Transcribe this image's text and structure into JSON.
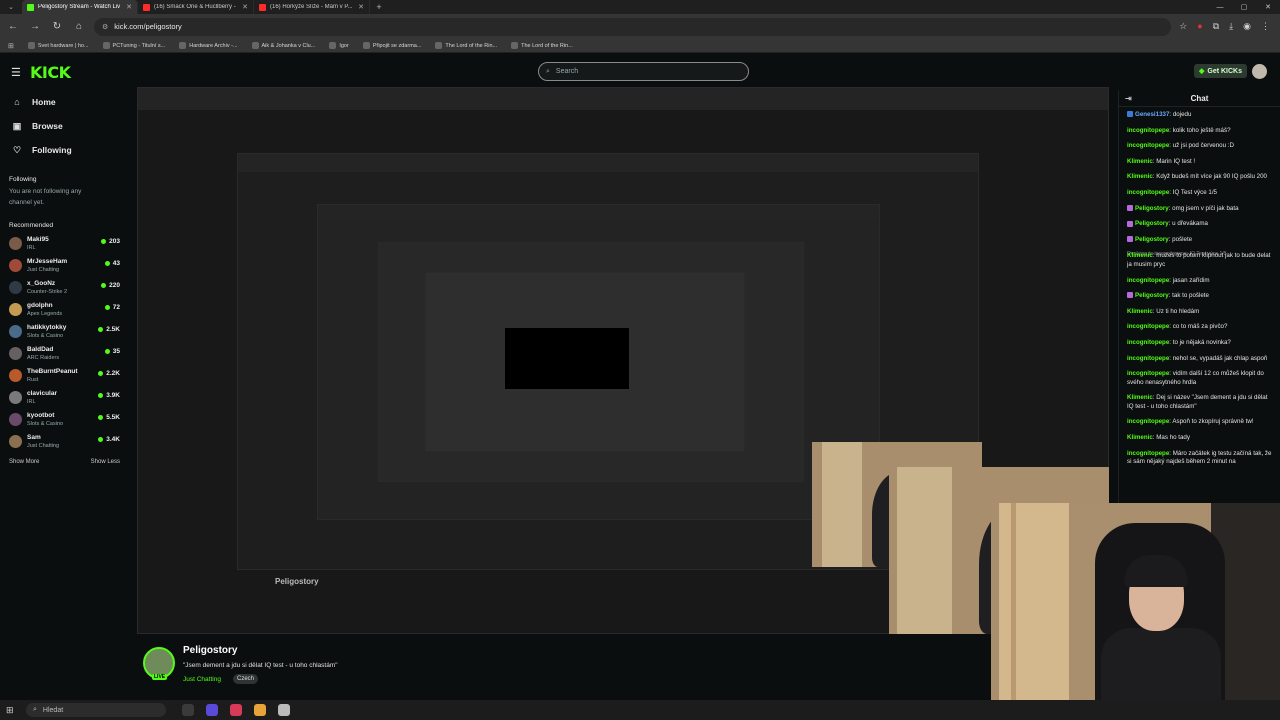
{
  "browser": {
    "tabs": [
      {
        "title": "Peligostory Stream - Watch Liv",
        "color": "#53fc18",
        "active": true
      },
      {
        "title": "(16) Smack One & Hucllberry -",
        "color": "#ff2b2b",
        "active": false
      },
      {
        "title": "(16) Horkýže Slíže - Mám v P...",
        "color": "#ff2b2b",
        "active": false
      }
    ],
    "url": "kick.com/peligostory",
    "bookmarks": [
      "Svet hardware | ho...",
      "PCTuning - Titulní s...",
      "Hardware Archiv -...",
      "Aik & Johanka v Clu...",
      "Igor",
      "Připojit se zdarma...",
      "The Lord of the Rin...",
      "The Lord of the Rin..."
    ]
  },
  "header": {
    "logo": "KICK",
    "search_placeholder": "Search",
    "get_kicks": "Get KICKs"
  },
  "sidebar": {
    "nav": [
      {
        "label": "Home",
        "icon": "home-icon",
        "glyph": "⌂"
      },
      {
        "label": "Browse",
        "icon": "browse-icon",
        "glyph": "▣"
      },
      {
        "label": "Following",
        "icon": "heart-icon",
        "glyph": "♡"
      }
    ],
    "following_heading": "Following",
    "following_note": "You are not following any channel yet.",
    "recommended_heading": "Recommended",
    "recommended": [
      {
        "name": "Maki95",
        "category": "IRL",
        "viewers": "203",
        "color": "#7a5a48"
      },
      {
        "name": "MrJesseHam",
        "category": "Just Chatting",
        "viewers": "43",
        "color": "#a04a3a"
      },
      {
        "name": "x_GooNz",
        "category": "Counter-Strike 2",
        "viewers": "220",
        "color": "#303a46"
      },
      {
        "name": "gdolphn",
        "category": "Apex Legends",
        "viewers": "72",
        "color": "#c49a52"
      },
      {
        "name": "hatikkytokky",
        "category": "Slots & Casino",
        "viewers": "2.5K",
        "color": "#4a6a8a"
      },
      {
        "name": "BaldDad",
        "category": "ARC Raiders",
        "viewers": "35",
        "color": "#666060"
      },
      {
        "name": "TheBurntPeanut",
        "category": "Rust",
        "viewers": "2.2K",
        "color": "#b85a2a"
      },
      {
        "name": "clavicular",
        "category": "IRL",
        "viewers": "3.9K",
        "color": "#7a7a7a"
      },
      {
        "name": "kyootbot",
        "category": "Slots & Casino",
        "viewers": "5.5K",
        "color": "#6a4a6a"
      },
      {
        "name": "Sam",
        "category": "Just Chatting",
        "viewers": "3.4K",
        "color": "#8a7050"
      }
    ],
    "show_more": "Show More",
    "show_less": "Show Less"
  },
  "stream": {
    "streamer": "Peligostory",
    "title": "\"Jsem dement a jdu si dělat IQ test - u toho chlastám\"",
    "category": "Just Chatting",
    "tag": "Czech",
    "live_badge": "LIVE"
  },
  "chat": {
    "heading": "Chat",
    "messages": [
      {
        "user": "Genesi1337",
        "text": "dojedu",
        "color": "#6aa8ff",
        "badge": "#3a7ad8",
        "reply": ""
      },
      {
        "user": "incognitopepe",
        "text": "kolik toho ještě máš?",
        "color": "#53fc18",
        "badge": "",
        "reply": ""
      },
      {
        "user": "incognitopepe",
        "text": "už jsi pod červenou :D",
        "color": "#53fc18",
        "badge": "",
        "reply": ""
      },
      {
        "user": "Klimenic",
        "text": "Marin IQ test !",
        "color": "#53fc18",
        "badge": "",
        "reply": ""
      },
      {
        "user": "Klimenic",
        "text": "Když budeš mít více jak 90 IQ pošlu 200",
        "color": "#53fc18",
        "badge": "",
        "reply": ""
      },
      {
        "user": "incognitopepe",
        "text": "IQ Test výce 1/5",
        "color": "#53fc18",
        "badge": "",
        "reply": ""
      },
      {
        "user": "Peligostory",
        "text": "omg jsem v píči jak bata",
        "color": "#53fc18",
        "badge": "#b46ad8",
        "reply": ""
      },
      {
        "user": "Peligostory",
        "text": "u dřevákama",
        "color": "#53fc18",
        "badge": "#b46ad8",
        "reply": ""
      },
      {
        "user": "Peligostory",
        "text": "pošlete",
        "color": "#53fc18",
        "badge": "#b46ad8",
        "reply": ""
      },
      {
        "user": "Klimenic",
        "text": "muzes to potom klipnout jak to bude delat ja musim pryc",
        "color": "#53fc18",
        "badge": "",
        "reply": "Replying to incognitopepe: IQ Test výce 1/5"
      },
      {
        "user": "incognitopepe",
        "text": "jasan zařídim",
        "color": "#53fc18",
        "badge": "",
        "reply": ""
      },
      {
        "user": "Peligostory",
        "text": "tak to pošlete",
        "color": "#53fc18",
        "badge": "#b46ad8",
        "reply": ""
      },
      {
        "user": "Klimenic",
        "text": "Uz ti ho hledám",
        "color": "#53fc18",
        "badge": "",
        "reply": ""
      },
      {
        "user": "incognitopepe",
        "text": "co to máš za pivčo?",
        "color": "#53fc18",
        "badge": "",
        "reply": ""
      },
      {
        "user": "incognitopepe",
        "text": "to je nějaká novinka?",
        "color": "#53fc18",
        "badge": "",
        "reply": ""
      },
      {
        "user": "incognitopepe",
        "text": "nehol se, vypadáš jak chlap aspoň",
        "color": "#53fc18",
        "badge": "",
        "reply": ""
      },
      {
        "user": "incognitopepe",
        "text": "vidím další 12 co můžeš klopit do svého nenasytného hrdla",
        "color": "#53fc18",
        "badge": "",
        "reply": ""
      },
      {
        "user": "Klimenic",
        "text": "Dej si název \"Jsem dement a jdu si dělat IQ test - u toho chlastám\"",
        "color": "#53fc18",
        "badge": "",
        "reply": ""
      },
      {
        "user": "incognitopepe",
        "text": "Aspoň to zkopíruj správně tw!",
        "color": "#53fc18",
        "badge": "",
        "reply": ""
      },
      {
        "user": "Klimenic",
        "text": "Mas ho tady",
        "color": "#53fc18",
        "badge": "",
        "reply": ""
      },
      {
        "user": "incognitopepe",
        "text": "Máro začátek ig testu začíná tak, že si sám nějaký najdeš během 2 minut na",
        "color": "#53fc18",
        "badge": "",
        "reply": ""
      }
    ]
  },
  "taskbar": {
    "search_placeholder": "Hledat",
    "apps": [
      "#3a3a3a",
      "#5a4ad8",
      "#d83a5a",
      "#e8a43a",
      "#bbbbbb"
    ]
  },
  "colors": {
    "accent": "#53fc18",
    "background": "#0b0e0f"
  }
}
